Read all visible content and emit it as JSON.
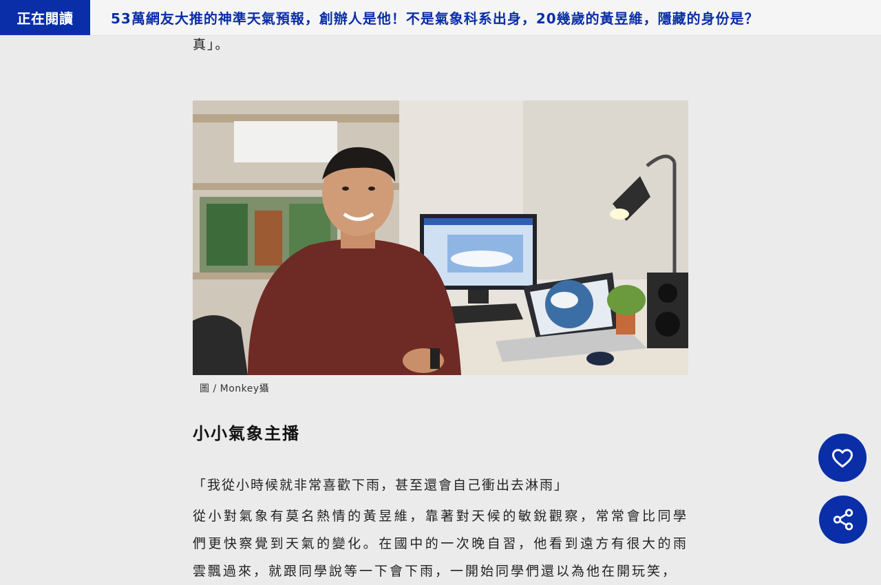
{
  "header": {
    "reading_label": "正在閱讀",
    "reading_title": "53萬網友大推的神準天氣預報，創辦人是他！不是氣象科系出身，20幾歲的黃昱維，隱藏的身份是？"
  },
  "article": {
    "previous_line_tail": "真」。",
    "photo_caption": "圖 / Monkey攝",
    "section_heading": "小小氣象主播",
    "quote": "「我從小時候就非常喜歡下雨，甚至還會自己衝出去淋雨」",
    "paragraph": "從小對氣象有莫名熱情的黃昱維，靠著對天候的敏銳觀察，常常會比同學們更快察覺到天氣的變化。在國中的一次晚自習，他看到遠方有很大的雨雲飄過來，就跟同學說等一下會下雨，一開始同學們還以為他在開玩笑，"
  },
  "floating_actions": {
    "like_icon": "heart-icon",
    "share_icon": "share-icon"
  },
  "colors": {
    "brand": "#0a2ea8",
    "background": "#ebebeb"
  }
}
